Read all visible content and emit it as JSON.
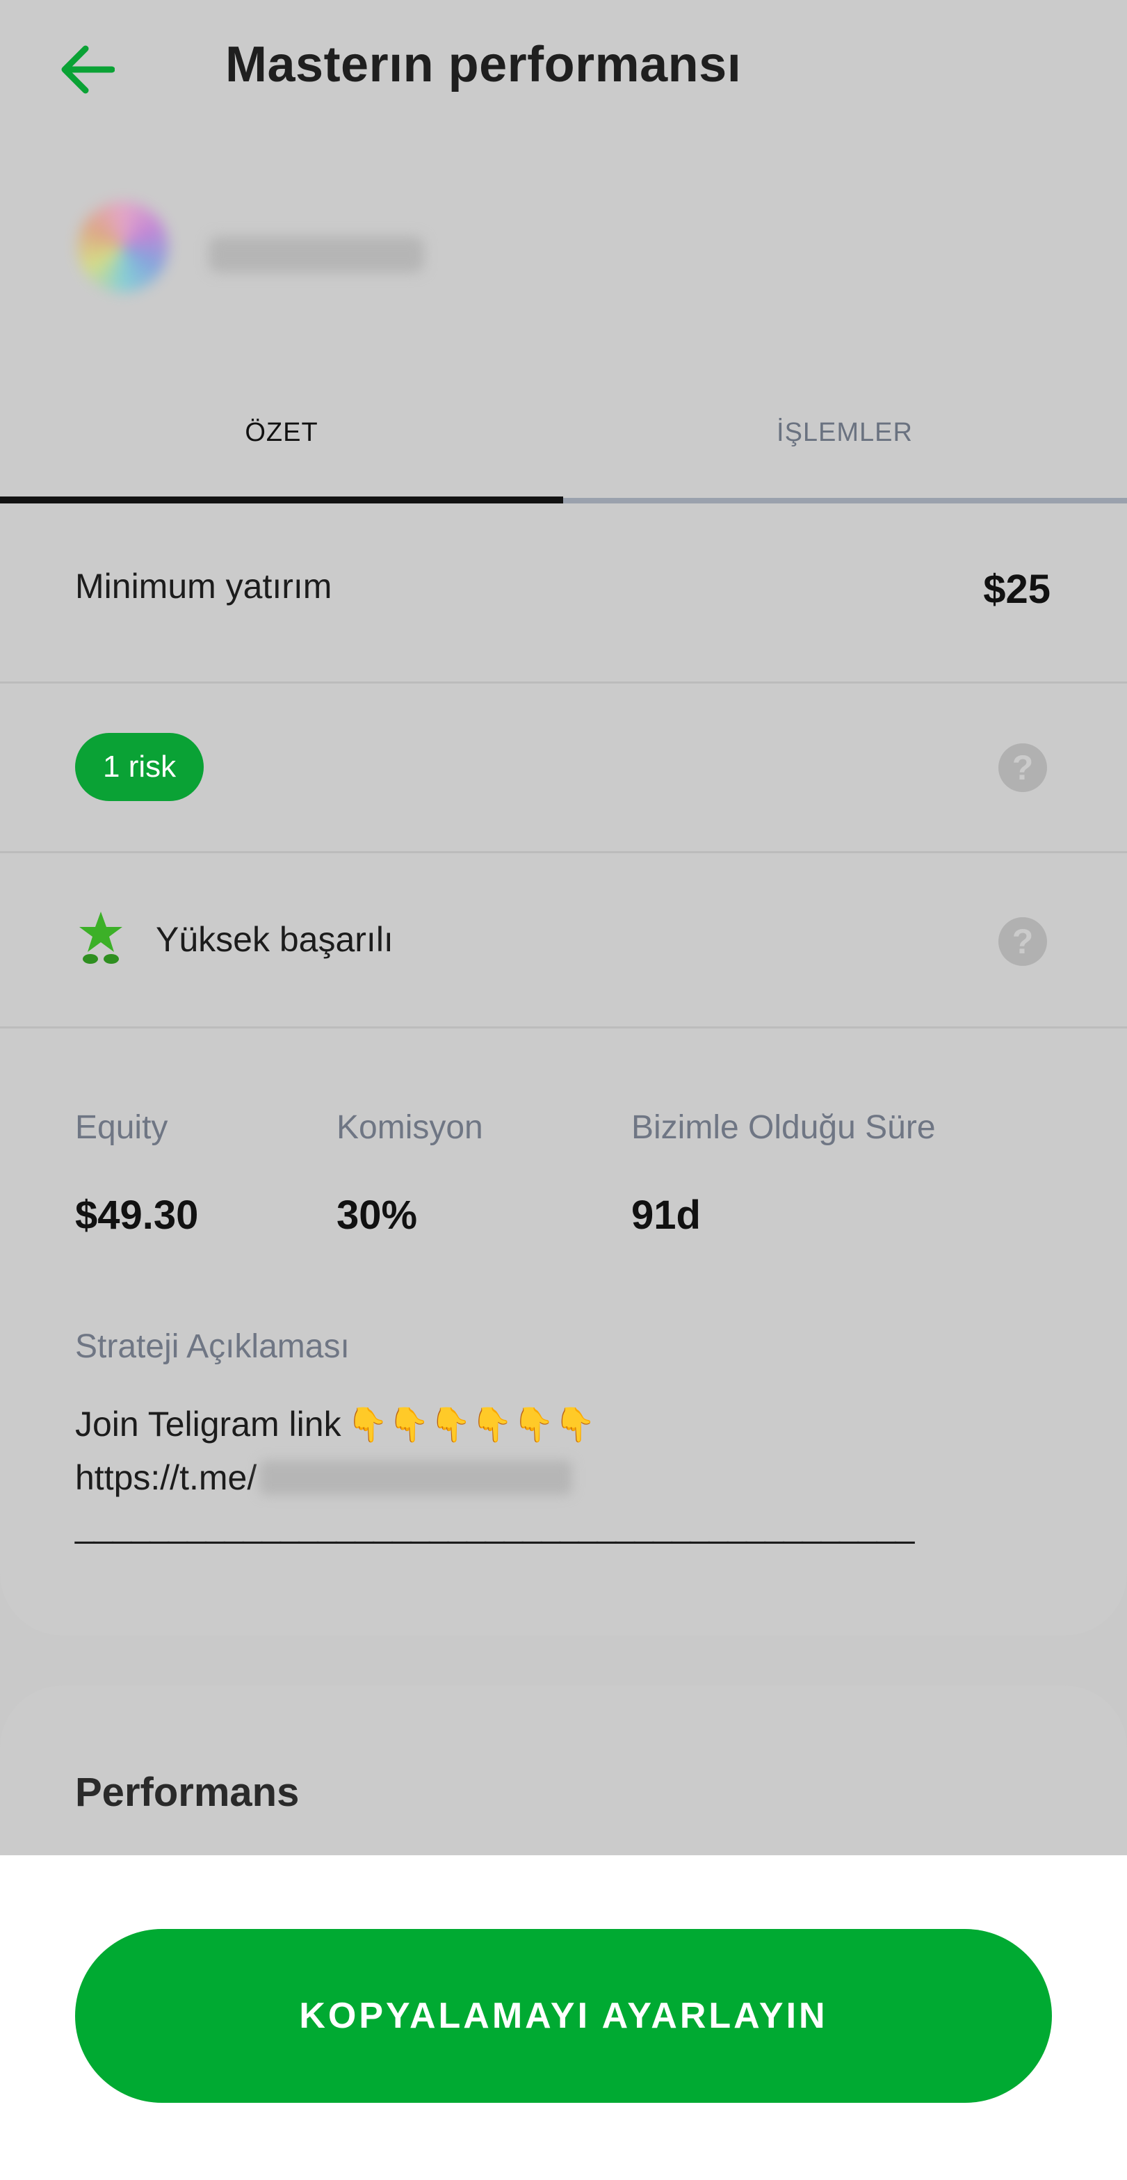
{
  "header": {
    "title": "Masterın performansı",
    "back_icon": "arrow-left-icon",
    "accent_color": "#0aa235"
  },
  "tabs": [
    {
      "label": "ÖZET",
      "active": true
    },
    {
      "label": "İŞLEMLER",
      "active": false
    }
  ],
  "summary": {
    "min_investment_label": "Minimum yatırım",
    "min_investment_value": "$25",
    "risk_badge": "1 risk",
    "success_label": "Yüksek başarılı",
    "help_icon": "question-icon",
    "star_icon": "star-icon",
    "stats": [
      {
        "label": "Equity",
        "value": "$49.30"
      },
      {
        "label": "Komisyon",
        "value": "30%"
      },
      {
        "label": "Bizimle Olduğu Süre",
        "value": "91d"
      }
    ],
    "strategy_title": "Strateji Açıklaması",
    "strategy_line1": "Join Teligram link",
    "strategy_hands": "👇👇👇👇👇👇",
    "strategy_line2_prefix": "https://t.me/",
    "strategy_line3": "_____________________________________________"
  },
  "performance": {
    "title": "Performans"
  },
  "cta": {
    "label": "KOPYALAMAYI AYARLAYIN",
    "color": "#00aa32"
  }
}
